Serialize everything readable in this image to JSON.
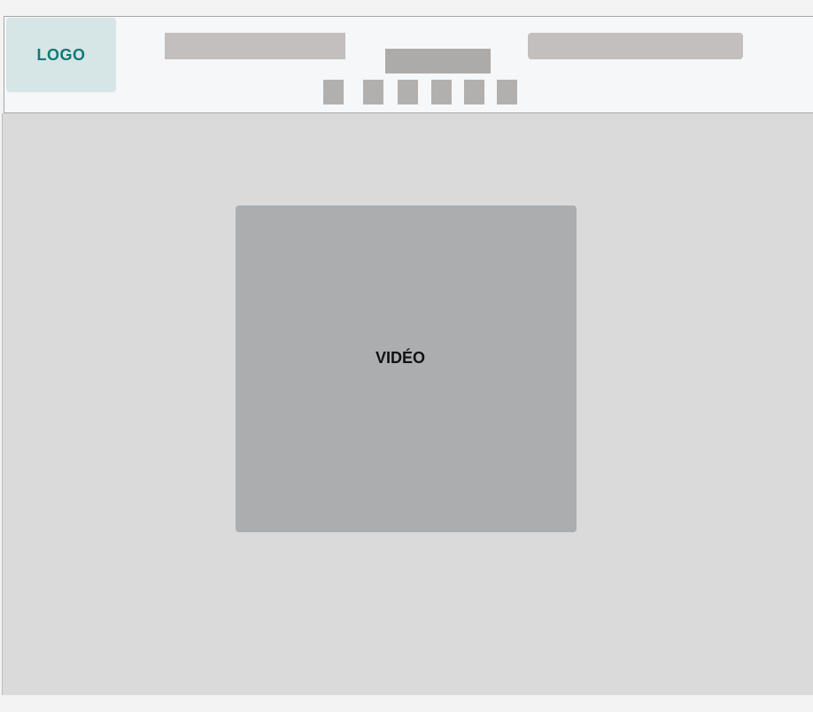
{
  "header": {
    "logo_text": "LOGO"
  },
  "main": {
    "video_label": "VIDÉO"
  }
}
